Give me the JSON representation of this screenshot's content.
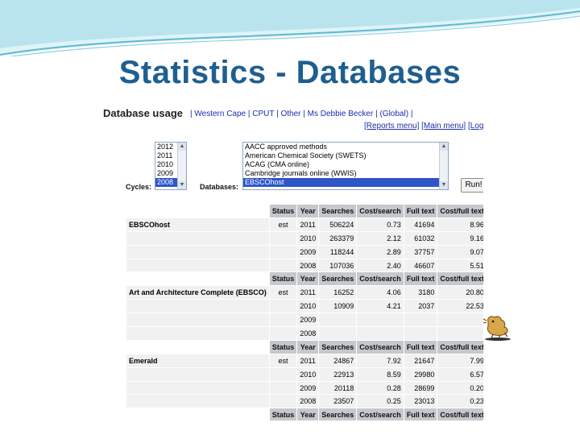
{
  "slide": {
    "title": "Statistics - Databases"
  },
  "header": {
    "title": "Database usage",
    "breadcrumb": [
      "| Western Cape | CPUT | Other | Ms Debbie Becker | (Global) |"
    ],
    "links": {
      "reports_menu": "[Reports menu]",
      "main_menu": "[Main menu]",
      "logout": "[Log o"
    }
  },
  "form": {
    "cycles_label": "Cycles:",
    "databases_label": "Databases:",
    "cycles": [
      "2012",
      "2011",
      "2010",
      "2009",
      "2008"
    ],
    "cycles_selected": "2008",
    "databases": [
      "AACC approved methods",
      "American Chemical Society (SWETS)",
      "ACAG (CMA online)",
      "Cambridge journals online (WWIS)",
      "EBSCOhost"
    ],
    "databases_selected": "EBSCOhost",
    "run_label": "Run!"
  },
  "table": {
    "columns": [
      "Status",
      "Year",
      "Searches",
      "Cost/search",
      "Full text",
      "Cost/full text"
    ],
    "groups": [
      {
        "name": "EBSCOhost",
        "status": "est",
        "rows": [
          [
            "2011",
            "506224",
            "0.73",
            "41694",
            "8.96"
          ],
          [
            "2010",
            "263379",
            "2.12",
            "61032",
            "9.16"
          ],
          [
            "2009",
            "118244",
            "2.89",
            "37757",
            "9.07"
          ],
          [
            "2008",
            "107036",
            "2.40",
            "46607",
            "5.51"
          ]
        ]
      },
      {
        "name": "Art and Architecture Complete (EBSCO)",
        "status": "est",
        "rows": [
          [
            "2011",
            "16252",
            "4.06",
            "3180",
            "20.80"
          ],
          [
            "2010",
            "10909",
            "4.21",
            "2037",
            "22.53"
          ],
          [
            "2009",
            "",
            "",
            "",
            ""
          ],
          [
            "2008",
            "",
            "",
            "",
            ""
          ]
        ]
      },
      {
        "name": "Emerald",
        "status": "est",
        "rows": [
          [
            "2011",
            "24867",
            "7.92",
            "21647",
            "7.99"
          ],
          [
            "2010",
            "22913",
            "8.59",
            "29980",
            "6.57"
          ],
          [
            "2009",
            "20118",
            "0.28",
            "28699",
            "0.20"
          ],
          [
            "2008",
            "23507",
            "0.25",
            "23013",
            "0.23"
          ]
        ]
      }
    ]
  },
  "colors": {
    "title": "#1f5f8f",
    "selection": "#2f55c9",
    "header_cell": "#c5c8cc",
    "link": "#1a2fa8"
  },
  "icons": {
    "cursor": "animated-dog-cursor-icon"
  }
}
